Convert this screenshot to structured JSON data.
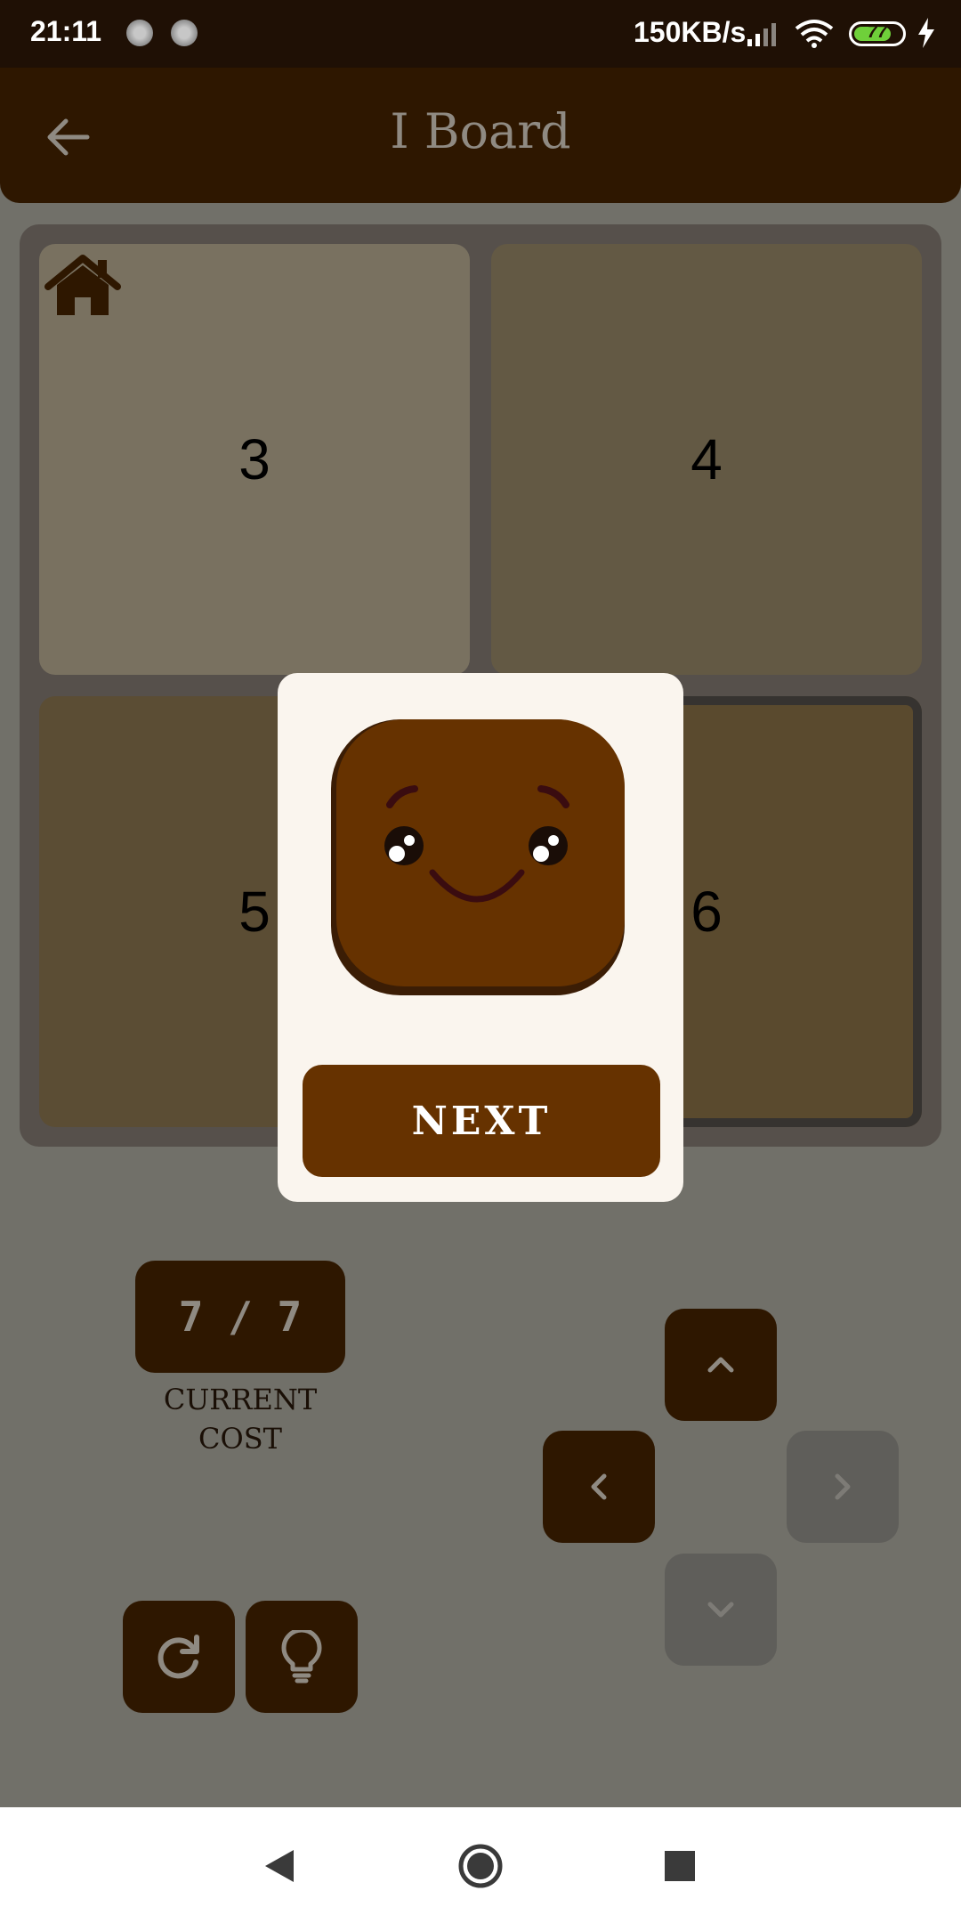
{
  "status_bar": {
    "time": "21:11",
    "network_speed": "150KB/s",
    "battery": "77",
    "icons": [
      "notification-dot-icon",
      "notification-dot-icon",
      "signal-icon",
      "wifi-icon",
      "battery-icon",
      "charging-bolt-icon"
    ]
  },
  "app_bar": {
    "title": "I Board",
    "back_icon": "arrow-left-icon"
  },
  "board": {
    "cells": [
      {
        "number": "3",
        "icon": "home-icon"
      },
      {
        "number": "4"
      },
      {
        "number": "5"
      },
      {
        "number": "6",
        "selected": true
      }
    ]
  },
  "dialog": {
    "character": "smiling-brown-block",
    "next_label": "NEXT"
  },
  "cost": {
    "value": "7 / 7",
    "label": "CURRENT COST"
  },
  "controls": {
    "up": {
      "icon": "chevron-up-icon",
      "enabled": true
    },
    "left": {
      "icon": "chevron-left-icon",
      "enabled": true
    },
    "right": {
      "icon": "chevron-right-icon",
      "enabled": false
    },
    "down": {
      "icon": "chevron-down-icon",
      "enabled": false
    },
    "reset": {
      "icon": "refresh-icon"
    },
    "hint": {
      "icon": "lightbulb-icon"
    }
  },
  "nav_bar": {
    "icons": [
      "nav-back-icon",
      "nav-home-icon",
      "nav-recents-icon"
    ]
  },
  "colors": {
    "brand_dark": "#2e1700",
    "brand_brown": "#663200",
    "dialog_bg": "#faf5ee",
    "disabled": "#5f5e5a"
  }
}
